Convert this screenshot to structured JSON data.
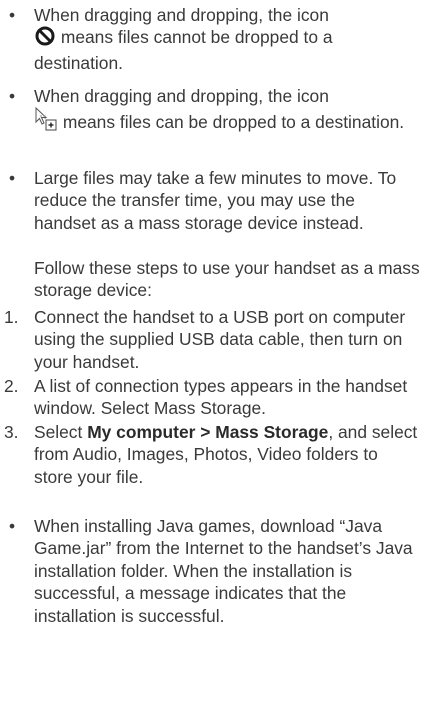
{
  "bullet_glyph": "•",
  "items": [
    {
      "marker": "•",
      "before_icon": "When dragging and dropping, the icon",
      "icon": "no-drop-icon",
      "after_icon": "means files cannot be dropped to a destination."
    },
    {
      "marker": "•",
      "before_icon": "When dragging and dropping, the icon",
      "icon": "copy-cursor-icon",
      "after_icon": "means files can be dropped to a destination."
    },
    {
      "marker": "•",
      "text": "Large files may take a few minutes to move. To reduce the transfer time, you may use the handset as a mass storage device instead."
    }
  ],
  "steps_intro": "Follow these steps to use your handset as a mass storage device:",
  "steps": [
    {
      "number": "1.",
      "text": "Connect the handset to a USB port on computer using the supplied USB data cable, then turn on your handset."
    },
    {
      "number": "2.",
      "text": "A list of connection types appears in the handset window. Select Mass Storage."
    },
    {
      "number": "3.",
      "text_before": "Select",
      "bold": "My computer > Mass Storage",
      "text_after": ", and select from Audio, Images, Photos, Video folders to store your file."
    }
  ],
  "java_item": {
    "marker": "•",
    "text": "When installing Java games, download “Java Game.jar” from the Internet to the handset’s Java installation folder. When the installation is successful, a message indicates that the installation is successful."
  }
}
